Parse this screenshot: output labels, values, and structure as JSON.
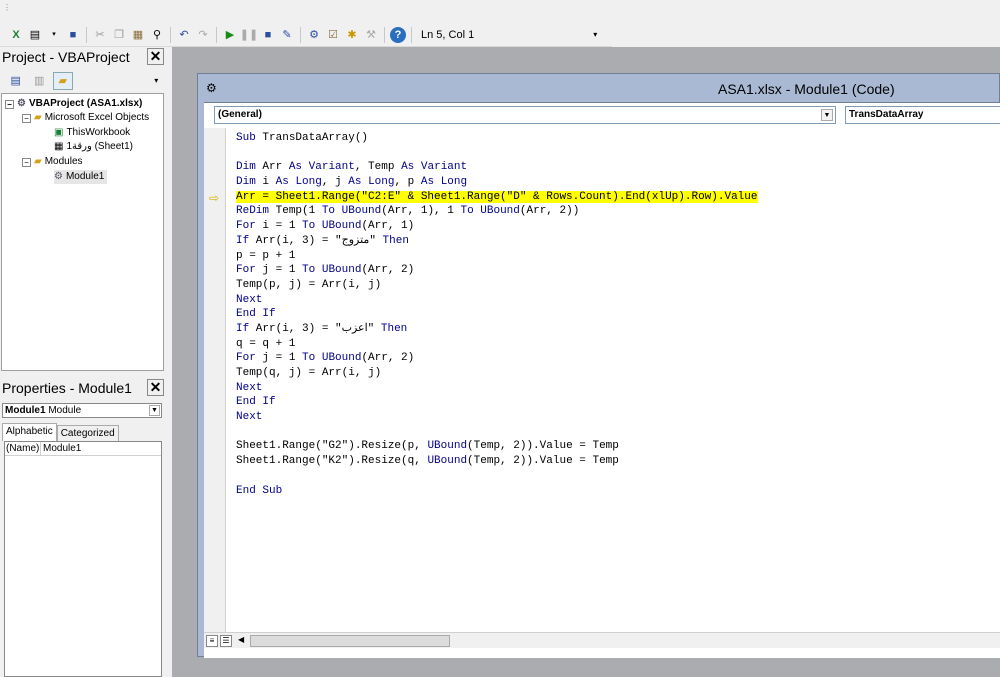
{
  "toolbar": {
    "status": "Ln 5, Col 1",
    "icons": [
      "view-excel-icon",
      "insert-module-icon",
      "save-icon",
      "cut-icon",
      "copy-icon",
      "paste-icon",
      "find-icon",
      "undo-icon",
      "redo-icon",
      "run-icon",
      "break-icon",
      "reset-icon",
      "design-mode-icon",
      "project-explorer-icon",
      "properties-icon",
      "object-browser-icon",
      "toolbox-icon",
      "help-icon"
    ]
  },
  "project": {
    "title": "Project - VBAProject",
    "close": "✕",
    "tree": {
      "root": "VBAProject (ASA1.xlsx)",
      "folder_objects": "Microsoft Excel Objects",
      "this_workbook": "ThisWorkbook",
      "sheet1": "ورقة1 (Sheet1)",
      "folder_modules": "Modules",
      "module1": "Module1"
    }
  },
  "properties": {
    "title": "Properties - Module1",
    "close": "✕",
    "object_name": "Module1",
    "object_type": "Module",
    "tab_alphabetic": "Alphabetic",
    "tab_categorized": "Categorized",
    "row_key": "(Name)",
    "row_value": "Module1"
  },
  "code_window": {
    "title": "ASA1.xlsx - Module1 (Code)",
    "object_combo": "(General)",
    "proc_combo": "TransDataArray",
    "execution_line_index": 4,
    "lines": [
      [
        [
          "kw",
          "Sub"
        ],
        [
          "t",
          " TransDataArray()"
        ]
      ],
      [
        [
          "t",
          ""
        ]
      ],
      [
        [
          "kw",
          "Dim"
        ],
        [
          "t",
          " Arr "
        ],
        [
          "kw",
          "As"
        ],
        [
          "t",
          " "
        ],
        [
          "kw",
          "Variant"
        ],
        [
          "t",
          ", Temp "
        ],
        [
          "kw",
          "As"
        ],
        [
          "t",
          " "
        ],
        [
          "kw",
          "Variant"
        ]
      ],
      [
        [
          "kw",
          "Dim"
        ],
        [
          "t",
          " i "
        ],
        [
          "kw",
          "As"
        ],
        [
          "t",
          " "
        ],
        [
          "kw",
          "Long"
        ],
        [
          "t",
          ", j "
        ],
        [
          "kw",
          "As"
        ],
        [
          "t",
          " "
        ],
        [
          "kw",
          "Long"
        ],
        [
          "t",
          ", p "
        ],
        [
          "kw",
          "As"
        ],
        [
          "t",
          " "
        ],
        [
          "kw",
          "Long"
        ]
      ],
      [
        [
          "t",
          "Arr = Sheet1.Range(\"C2:E\" & Sheet1.Range(\"D\" & Rows.Count).End(xlUp).Row).Value"
        ]
      ],
      [
        [
          "kw",
          "ReDim"
        ],
        [
          "t",
          " Temp(1 "
        ],
        [
          "kw",
          "To"
        ],
        [
          "t",
          " "
        ],
        [
          "kw",
          "UBound"
        ],
        [
          "t",
          "(Arr, 1), 1 "
        ],
        [
          "kw",
          "To"
        ],
        [
          "t",
          " "
        ],
        [
          "kw",
          "UBound"
        ],
        [
          "t",
          "(Arr, 2))"
        ]
      ],
      [
        [
          "kw",
          "For"
        ],
        [
          "t",
          " i = 1 "
        ],
        [
          "kw",
          "To"
        ],
        [
          "t",
          " "
        ],
        [
          "kw",
          "UBound"
        ],
        [
          "t",
          "(Arr, 1)"
        ]
      ],
      [
        [
          "kw",
          "If"
        ],
        [
          "t",
          " Arr(i, 3) = \"متزوج\" "
        ],
        [
          "kw",
          "Then"
        ]
      ],
      [
        [
          "t",
          "p = p + 1"
        ]
      ],
      [
        [
          "kw",
          "For"
        ],
        [
          "t",
          " j = 1 "
        ],
        [
          "kw",
          "To"
        ],
        [
          "t",
          " "
        ],
        [
          "kw",
          "UBound"
        ],
        [
          "t",
          "(Arr, 2)"
        ]
      ],
      [
        [
          "t",
          "Temp(p, j) = Arr(i, j)"
        ]
      ],
      [
        [
          "kw",
          "Next"
        ]
      ],
      [
        [
          "kw",
          "End If"
        ]
      ],
      [
        [
          "kw",
          "If"
        ],
        [
          "t",
          " Arr(i, 3) = \"اعزب\" "
        ],
        [
          "kw",
          "Then"
        ]
      ],
      [
        [
          "t",
          "q = q + 1"
        ]
      ],
      [
        [
          "kw",
          "For"
        ],
        [
          "t",
          " j = 1 "
        ],
        [
          "kw",
          "To"
        ],
        [
          "t",
          " "
        ],
        [
          "kw",
          "UBound"
        ],
        [
          "t",
          "(Arr, 2)"
        ]
      ],
      [
        [
          "t",
          "Temp(q, j) = Arr(i, j)"
        ]
      ],
      [
        [
          "kw",
          "Next"
        ]
      ],
      [
        [
          "kw",
          "End If"
        ]
      ],
      [
        [
          "kw",
          "Next"
        ]
      ],
      [
        [
          "t",
          ""
        ]
      ],
      [
        [
          "t",
          "Sheet1.Range(\"G2\").Resize(p, "
        ],
        [
          "kw",
          "UBound"
        ],
        [
          "t",
          "(Temp, 2)).Value = Temp"
        ]
      ],
      [
        [
          "t",
          "Sheet1.Range(\"K2\").Resize(q, "
        ],
        [
          "kw",
          "UBound"
        ],
        [
          "t",
          "(Temp, 2)).Value = Temp"
        ]
      ],
      [
        [
          "t",
          ""
        ]
      ],
      [
        [
          "kw",
          "End Sub"
        ]
      ]
    ]
  },
  "colors": {
    "keyword": "#00008b",
    "highlight": "#ffff00",
    "mdi_bg": "#abacb0",
    "window_frame": "#a9b9d4"
  }
}
